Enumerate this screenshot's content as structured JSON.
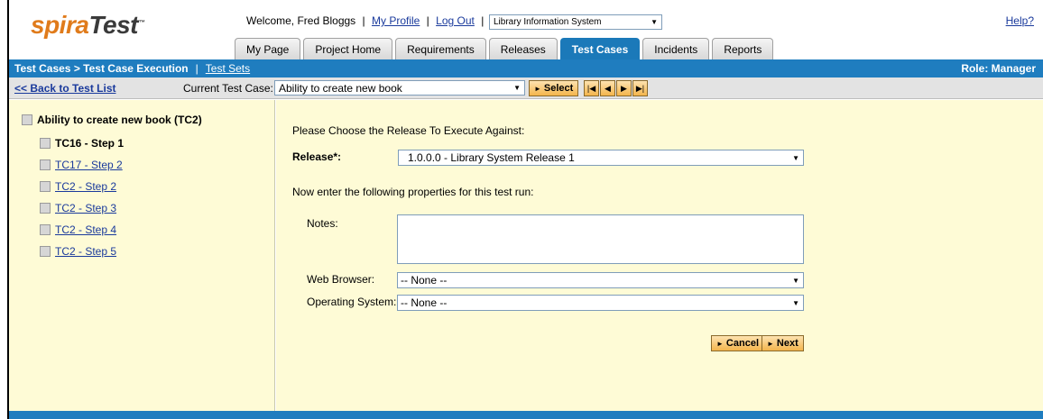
{
  "header": {
    "logo_spira": "spira",
    "logo_test": "Test",
    "logo_tm": "™",
    "welcome": "Welcome, Fred Bloggs",
    "separator": "|",
    "my_profile": "My Profile",
    "log_out": "Log Out",
    "project": "Library Information System",
    "help": "Help?"
  },
  "tabs": [
    "My Page",
    "Project Home",
    "Requirements",
    "Releases",
    "Test Cases",
    "Incidents",
    "Reports"
  ],
  "active_tab": "Test Cases",
  "navbar": {
    "breadcrumb": "Test Cases > Test Case Execution",
    "pipe": "|",
    "test_sets": "Test Sets",
    "role": "Role: Manager"
  },
  "toolbar": {
    "back": "<< Back to Test List",
    "current_label": "Current Test Case:",
    "current_value": "Ability to create new book",
    "select_label": "Select"
  },
  "tree": {
    "root": "Ability to create new book (TC2)",
    "steps": [
      {
        "label": "TC16 - Step 1",
        "current": true
      },
      {
        "label": "TC17 - Step 2",
        "current": false
      },
      {
        "label": "TC2 - Step 2",
        "current": false
      },
      {
        "label": "TC2 - Step 3",
        "current": false
      },
      {
        "label": "TC2 - Step 4",
        "current": false
      },
      {
        "label": "TC2 - Step 5",
        "current": false
      }
    ]
  },
  "form": {
    "choose_release": "Please Choose the Release To Execute Against:",
    "release_label": "Release*:",
    "release_value": "1.0.0.0 - Library System Release 1",
    "properties_prompt": "Now enter the following properties for this test run:",
    "notes_label": "Notes:",
    "notes_value": "",
    "web_browser_label": "Web Browser:",
    "web_browser_value": "-- None --",
    "os_label": "Operating System:",
    "os_value": "-- None --",
    "cancel_label": "Cancel",
    "next_label": "Next"
  },
  "colors": {
    "brand_blue": "#1f7dbf",
    "panel_bg": "#fefbd6",
    "logo_orange": "#e07b1b"
  }
}
